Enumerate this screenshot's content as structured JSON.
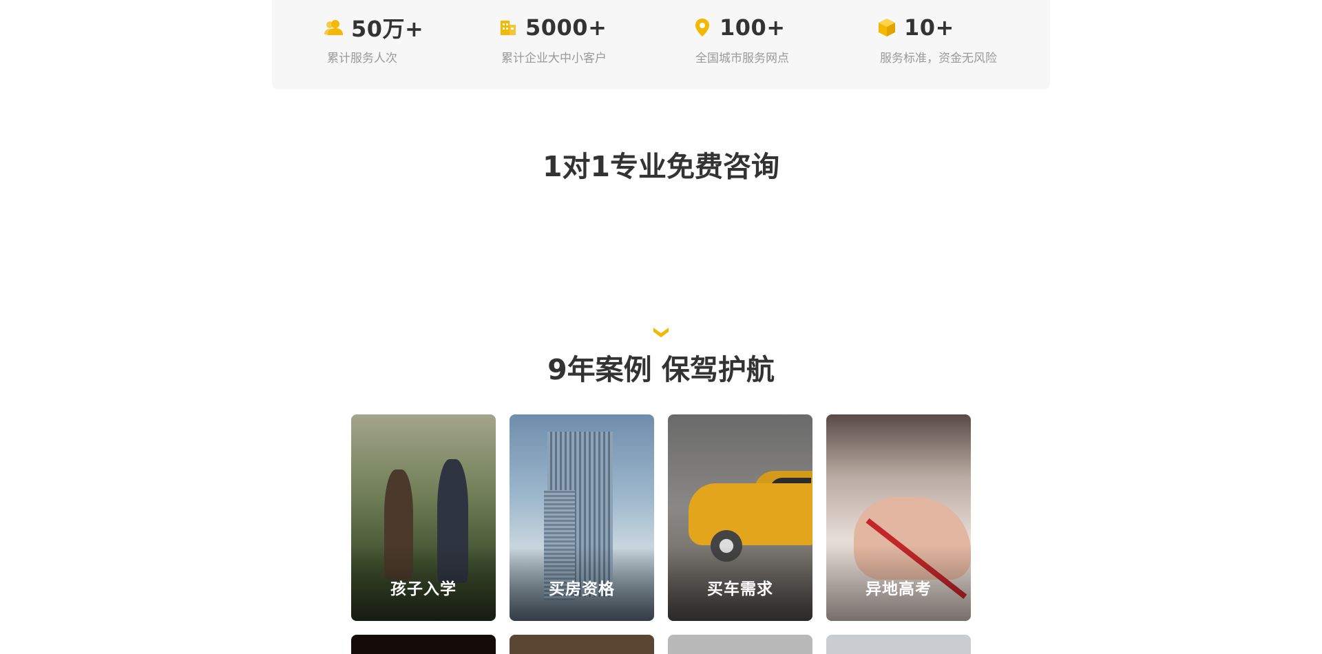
{
  "stats": [
    {
      "icon": "users-icon",
      "value": "50万+",
      "label": "累计服务人次"
    },
    {
      "icon": "building-icon",
      "value": "5000+",
      "label": "累计企业大中小客户"
    },
    {
      "icon": "location-pin-icon",
      "value": "100+",
      "label": "全国城市服务网点"
    },
    {
      "icon": "cube-icon",
      "value": "10+",
      "label": "服务标准，资金无风险"
    }
  ],
  "consult": {
    "title": "1对1专业免费咨询"
  },
  "cases": {
    "title": "9年案例 保驾护航",
    "cards": [
      {
        "label": "孩子入学"
      },
      {
        "label": "买房资格"
      },
      {
        "label": "买车需求"
      },
      {
        "label": "异地高考"
      }
    ]
  },
  "colors": {
    "accent": "#f5b800",
    "text": "#333333",
    "muted": "#999999",
    "panel": "#f7f7f7"
  }
}
